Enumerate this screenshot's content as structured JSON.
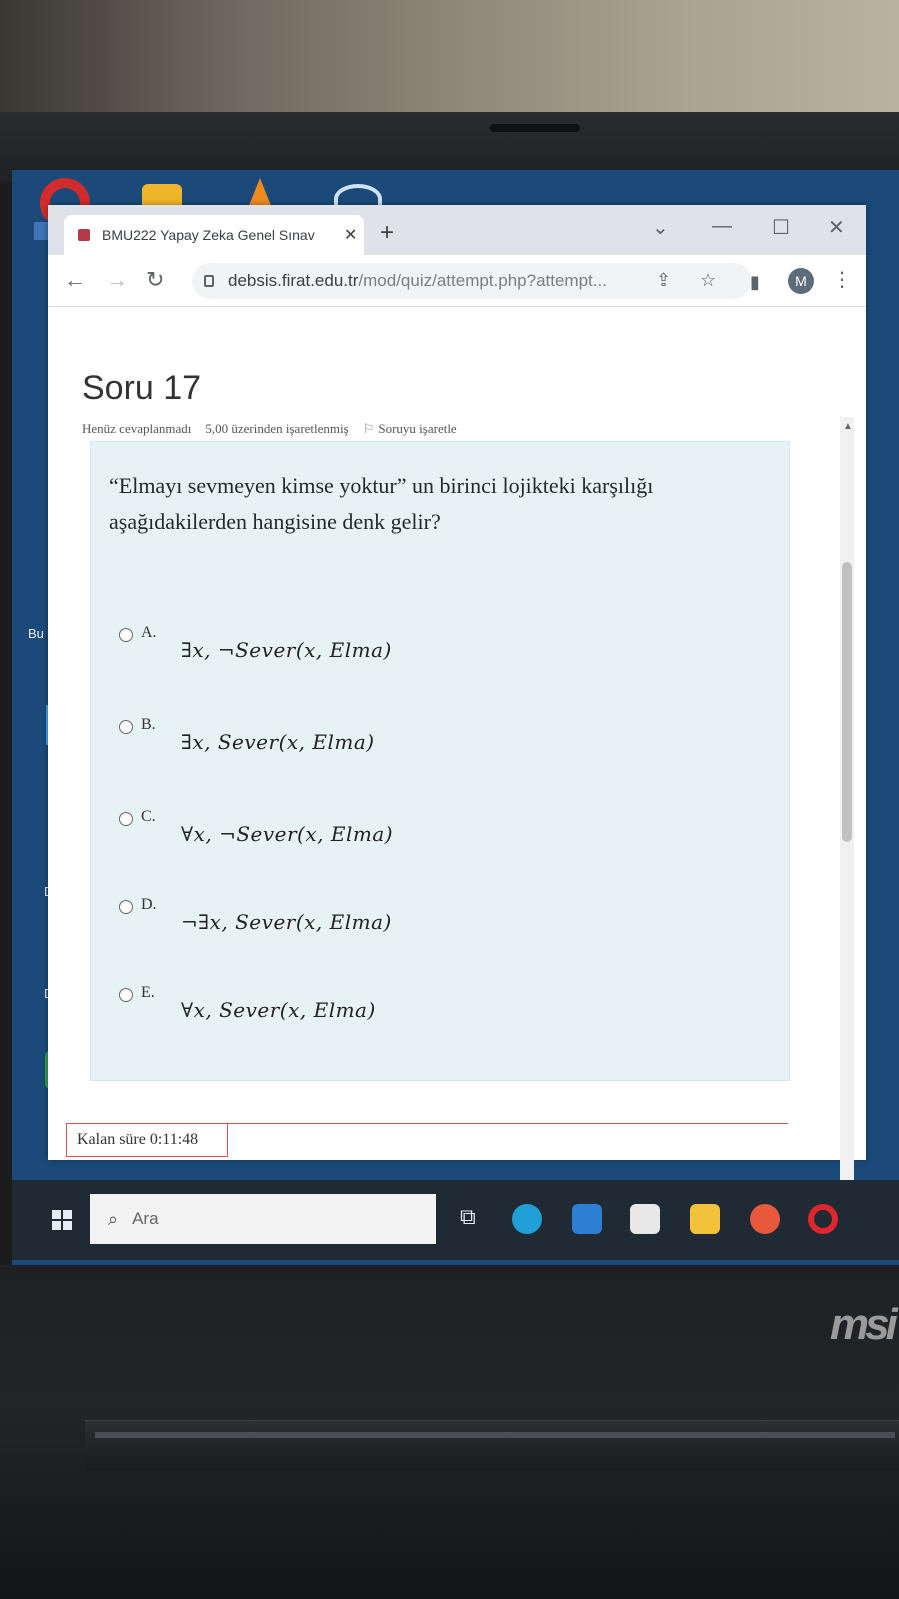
{
  "browser": {
    "tab_title": "BMU222 Yapay Zeka Genel Sınav",
    "tab_close": "✕",
    "new_tab": "+",
    "url_host": "debsis.firat.edu.tr",
    "url_path": "/mod/quiz/attempt.php?attempt...",
    "avatar_letter": "M"
  },
  "question": {
    "heading": "Soru 17",
    "status": "Henüz cevaplanmadı",
    "marks": "5,00 üzerinden işaretlenmiş",
    "flag_label": "Soruyu işaretle",
    "text": "“Elmayı sevmeyen kimse yoktur” un birinci lojikteki karşılığı aşağıdakilerden hangisine denk gelir?",
    "options": [
      {
        "letter": "A.",
        "formula": "∃x, ¬Sever(x, Elma)"
      },
      {
        "letter": "B.",
        "formula": "∃x, Sever(x, Elma)"
      },
      {
        "letter": "C.",
        "formula": "∀x, ¬Sever(x, Elma)"
      },
      {
        "letter": "D.",
        "formula": "¬∃x, Sever(x, Elma)"
      },
      {
        "letter": "E.",
        "formula": "∀x, Sever(x, Elma)"
      }
    ]
  },
  "timer": {
    "label": "Kalan süre 0:11:48"
  },
  "taskbar": {
    "search_placeholder": "Ara"
  },
  "desktop": {
    "label_bu": "Bu",
    "label_d1": "D",
    "label_d2": "D"
  },
  "colors": {
    "question_bg": "#e7f2f4",
    "timer_border": "#d9534f",
    "taskbar": "#1f2a35"
  },
  "device": {
    "brand": "msi"
  }
}
